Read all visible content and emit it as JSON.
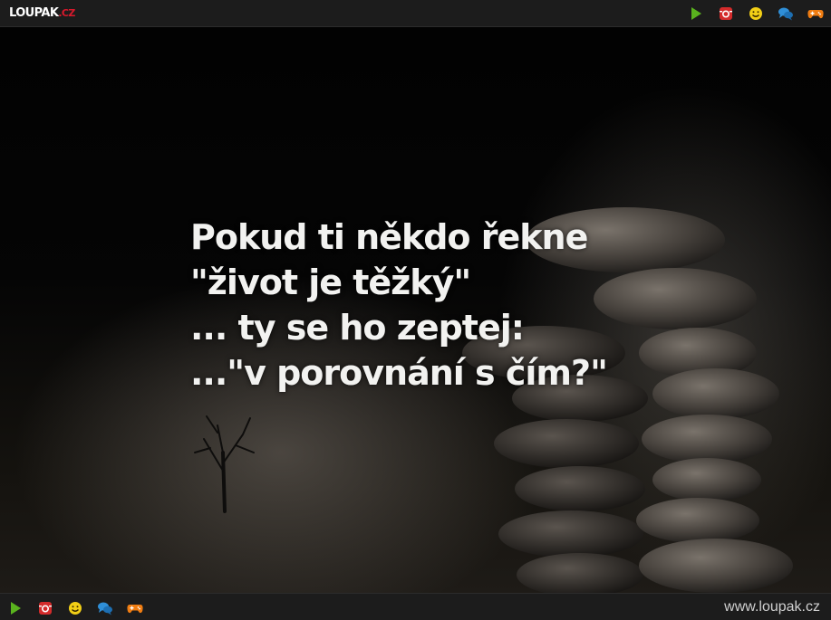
{
  "header": {
    "logo": {
      "main": "LOUPAK",
      "tld": ".CZ"
    },
    "icons": [
      "play-icon",
      "instagram-icon",
      "smiley-icon",
      "chat-icon",
      "gamepad-icon"
    ]
  },
  "content": {
    "quote_lines": [
      "Pokud ti někdo řekne",
      "\"život je těžký\"",
      "... ty se ho zeptej:",
      "...\"v porovnání s čím?\""
    ]
  },
  "footer": {
    "icons": [
      "play-icon",
      "instagram-icon",
      "smiley-icon",
      "chat-icon",
      "gamepad-icon"
    ],
    "site_url": "www.loupak.cz"
  },
  "colors": {
    "bar": "#1c1c1c",
    "logo_accent": "#d8192c",
    "play": "#5ab31e",
    "instagram": "#d42b2b",
    "smiley": "#f2cf16",
    "chat": "#2f8fd8",
    "gamepad": "#f07d12"
  }
}
